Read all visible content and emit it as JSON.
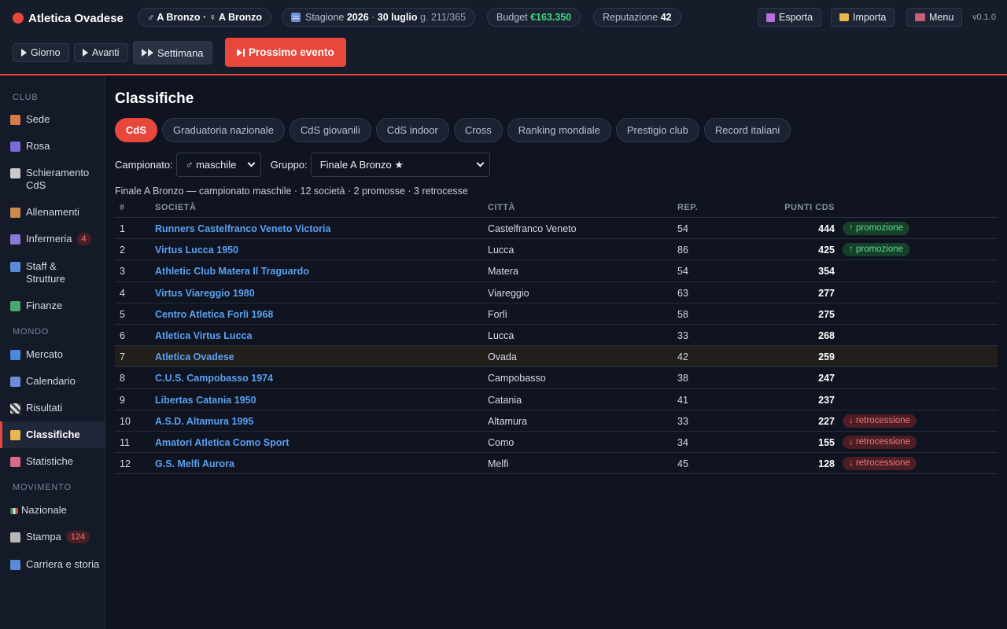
{
  "header": {
    "club_name": "Atletica Ovadese",
    "level_text": "♂ A Bronzo · ♀ A Bronzo",
    "season_label": "Stagione",
    "season_year": "2026",
    "date": "30 luglio",
    "day_counter": "g. 211/365",
    "budget_label": "Budget",
    "budget_value": "€163.350",
    "reputation_label": "Reputazione",
    "reputation_value": "42",
    "export_label": "Esporta",
    "import_label": "Importa",
    "menu_label": "Menu",
    "version": "v0.1.0"
  },
  "controls": {
    "day": "Giorno",
    "forward": "Avanti",
    "week": "Settimana",
    "next_event": "Prossimo evento"
  },
  "sidebar": {
    "sections": [
      "CLUB",
      "MONDO",
      "MOVIMENTO"
    ],
    "items": [
      {
        "label": "Sede"
      },
      {
        "label": "Rosa"
      },
      {
        "label": "Schieramento CdS"
      },
      {
        "label": "Allenamenti"
      },
      {
        "label": "Infermeria",
        "badge": "4"
      },
      {
        "label": "Staff & Strutture"
      },
      {
        "label": "Finanze"
      },
      {
        "label": "Mercato"
      },
      {
        "label": "Calendario"
      },
      {
        "label": "Risultati"
      },
      {
        "label": "Classifiche"
      },
      {
        "label": "Statistiche"
      },
      {
        "label": "Nazionale"
      },
      {
        "label": "Stampa",
        "badge": "124"
      },
      {
        "label": "Carriera e storia"
      }
    ],
    "active_item": "Classifiche"
  },
  "icons": [
    "house-icon",
    "users-icon",
    "clipboard-icon",
    "dumbbell-icon",
    "stethoscope-icon",
    "staff-icon",
    "money-icon",
    "transfer-icon",
    "calendar-icon",
    "checkered-flag-icon",
    "trophy-icon",
    "chart-icon",
    "flag-it-icon",
    "newspaper-icon",
    "career-icon"
  ],
  "main": {
    "title": "Classifiche",
    "tabs": [
      "CdS",
      "Graduatoria nazionale",
      "CdS giovanili",
      "CdS indoor",
      "Cross",
      "Ranking mondiale",
      "Prestigio club",
      "Record italiani"
    ],
    "active_tab": "CdS",
    "filters": {
      "championship_label": "Campionato:",
      "championship_value": "♂ maschile",
      "group_label": "Gruppo:",
      "group_value": "Finale A Bronzo ★"
    },
    "summary": "Finale A Bronzo — campionato maschile · 12 società · 2 promosse · 3 retrocesse",
    "columns": [
      "#",
      "SOCIETÀ",
      "CITTÀ",
      "REP.",
      "PUNTI CDS"
    ],
    "rows": [
      {
        "rank": "1",
        "club": "Runners Castelfranco Veneto Victoria",
        "city": "Castelfranco Veneto",
        "rep": "54",
        "points": "444",
        "tag": "↑ promozione",
        "tag_type": "promo"
      },
      {
        "rank": "2",
        "club": "Virtus Lucca 1950",
        "city": "Lucca",
        "rep": "86",
        "points": "425",
        "tag": "↑ promozione",
        "tag_type": "promo"
      },
      {
        "rank": "3",
        "club": "Athletic Club Matera Il Traguardo",
        "city": "Matera",
        "rep": "54",
        "points": "354",
        "tag": "",
        "tag_type": ""
      },
      {
        "rank": "4",
        "club": "Virtus Viareggio 1980",
        "city": "Viareggio",
        "rep": "63",
        "points": "277",
        "tag": "",
        "tag_type": ""
      },
      {
        "rank": "5",
        "club": "Centro Atletica Forlì 1968",
        "city": "Forlì",
        "rep": "58",
        "points": "275",
        "tag": "",
        "tag_type": ""
      },
      {
        "rank": "6",
        "club": "Atletica Virtus Lucca",
        "city": "Lucca",
        "rep": "33",
        "points": "268",
        "tag": "",
        "tag_type": ""
      },
      {
        "rank": "7",
        "club": "Atletica Ovadese",
        "city": "Ovada",
        "rep": "42",
        "points": "259",
        "tag": "",
        "tag_type": "",
        "highlight": true
      },
      {
        "rank": "8",
        "club": "C.U.S. Campobasso 1974",
        "city": "Campobasso",
        "rep": "38",
        "points": "247",
        "tag": "",
        "tag_type": ""
      },
      {
        "rank": "9",
        "club": "Libertas Catania 1950",
        "city": "Catania",
        "rep": "41",
        "points": "237",
        "tag": "",
        "tag_type": ""
      },
      {
        "rank": "10",
        "club": "A.S.D. Altamura 1995",
        "city": "Altamura",
        "rep": "33",
        "points": "227",
        "tag": "↓ retrocessione",
        "tag_type": "retro"
      },
      {
        "rank": "11",
        "club": "Amatori Atletica Como Sport",
        "city": "Como",
        "rep": "34",
        "points": "155",
        "tag": "↓ retrocessione",
        "tag_type": "retro"
      },
      {
        "rank": "12",
        "club": "G.S. Melfi Aurora",
        "city": "Melfi",
        "rep": "45",
        "points": "128",
        "tag": "↓ retrocessione",
        "tag_type": "retro"
      }
    ]
  },
  "colors": {
    "accent": "#e8473c",
    "link": "#5aa0f0",
    "budget": "#46d483",
    "promotion": "#5fdb8f",
    "relegation": "#f07a7a",
    "background": "#0f1420"
  }
}
